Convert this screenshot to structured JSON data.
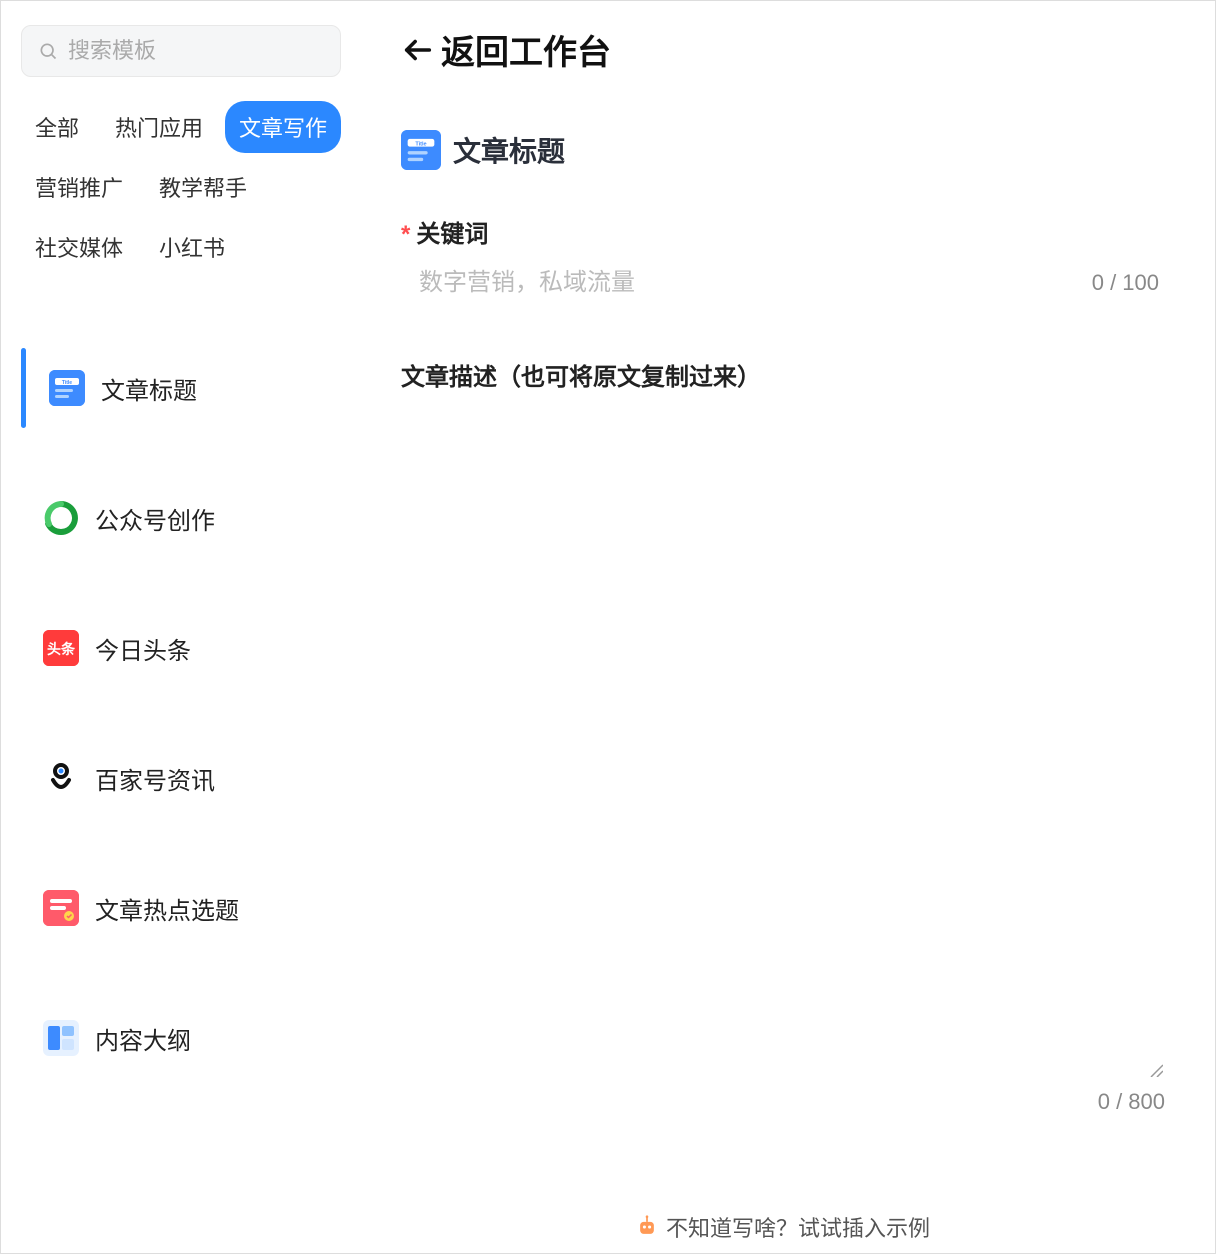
{
  "sidebar": {
    "search_placeholder": "搜索模板",
    "categories": [
      {
        "label": "全部",
        "active": false
      },
      {
        "label": "热门应用",
        "active": false
      },
      {
        "label": "文章写作",
        "active": true
      },
      {
        "label": "营销推广",
        "active": false
      },
      {
        "label": "教学帮手",
        "active": false
      },
      {
        "label": "社交媒体",
        "active": false
      },
      {
        "label": "小红书",
        "active": false
      }
    ],
    "templates": [
      {
        "label": "文章标题",
        "selected": true,
        "icon": "title"
      },
      {
        "label": "公众号创作",
        "selected": false,
        "icon": "wechat"
      },
      {
        "label": "今日头条",
        "selected": false,
        "icon": "toutiao"
      },
      {
        "label": "百家号资讯",
        "selected": false,
        "icon": "baijia"
      },
      {
        "label": "文章热点选题",
        "selected": false,
        "icon": "hot"
      },
      {
        "label": "内容大纲",
        "selected": false,
        "icon": "outline"
      }
    ]
  },
  "main": {
    "back_label": "返回工作台",
    "form_title": "文章标题",
    "field1_label": "关键词",
    "field1_placeholder": "数字营销，私域流量",
    "field1_counter": "0 / 100",
    "field2_label": "文章描述（也可将原文复制过来）",
    "field2_counter": "0 / 800",
    "hint_text": "不知道写啥？试试插入示例"
  }
}
